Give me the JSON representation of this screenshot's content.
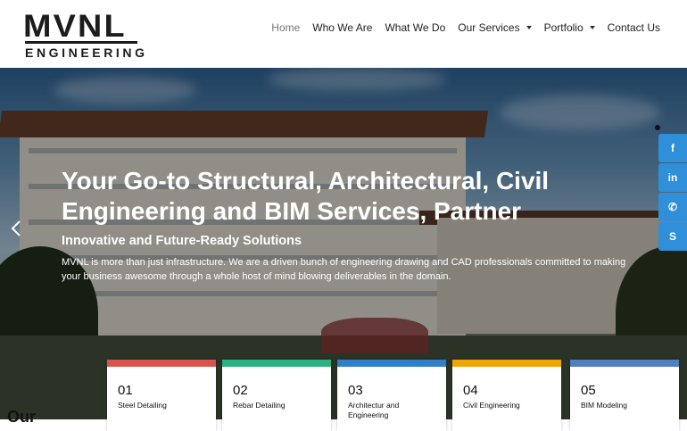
{
  "logo": {
    "word": "MVNL",
    "sub": "ENGINEERING"
  },
  "nav": {
    "items": [
      {
        "label": "Home",
        "active": true,
        "dropdown": false
      },
      {
        "label": "Who We Are",
        "active": false,
        "dropdown": false
      },
      {
        "label": "What We Do",
        "active": false,
        "dropdown": false
      },
      {
        "label": "Our Services",
        "active": false,
        "dropdown": true
      },
      {
        "label": "Portfolio",
        "active": false,
        "dropdown": true
      },
      {
        "label": "Contact Us",
        "active": false,
        "dropdown": false
      }
    ]
  },
  "hero": {
    "title": "Your Go-to Structural, Architectural, Civil Engineering and BIM Services, Partner",
    "subtitle": "Innovative and Future-Ready Solutions",
    "description": "MVNL is more than just infrastructure. We are a driven bunch of engineering drawing and CAD professionals committed to making your business awesome through a whole host of mind blowing deliverables in the domain."
  },
  "social": [
    {
      "icon": "facebook-icon",
      "glyph": "f",
      "color": "#2f8fd9"
    },
    {
      "icon": "linkedin-icon",
      "glyph": "in",
      "color": "#2f8fd9"
    },
    {
      "icon": "whatsapp-icon",
      "glyph": "✆",
      "color": "#2f8fd9"
    },
    {
      "icon": "skype-icon",
      "glyph": "S",
      "color": "#2f8fd9"
    }
  ],
  "services": [
    {
      "number": "01",
      "label": "Steel Detailing",
      "color": "#d9534f"
    },
    {
      "number": "02",
      "label": "Rebar Detailing",
      "color": "#2bb07f"
    },
    {
      "number": "03",
      "label": "Architectur and Engineering",
      "color": "#2f7ec9"
    },
    {
      "number": "04",
      "label": "Civil Engineering",
      "color": "#f0a500"
    },
    {
      "number": "05",
      "label": "BIM Modeling",
      "color": "#4f7fc0"
    }
  ],
  "section_heading": "Our"
}
